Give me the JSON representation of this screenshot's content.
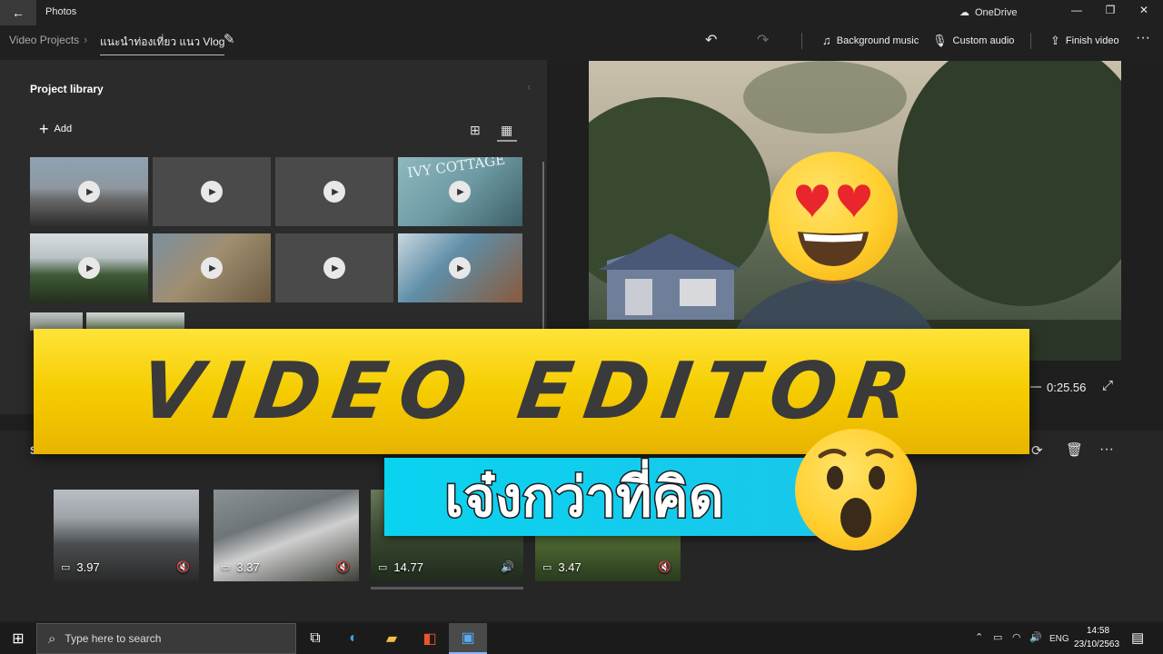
{
  "titlebar": {
    "back_icon": "←",
    "app_title": "Photos",
    "onedrive_icon": "☁",
    "onedrive_label": "OneDrive",
    "minimize_icon": "—",
    "maximize_icon": "❐",
    "close_icon": "✕"
  },
  "cmdbar": {
    "breadcrumb_root": "Video Projects",
    "breadcrumb_sep": "›",
    "project_name": "แนะนำท่องเที่ยว แนว Vlog",
    "edit_icon": "✎",
    "undo_icon": "↶",
    "redo_icon": "↷",
    "background_music_icon": "♫",
    "background_music_label": "Background music",
    "custom_audio_icon": "🎙",
    "custom_audio_label": "Custom audio",
    "finish_icon": "⇪",
    "finish_label": "Finish video",
    "more_icon": "···"
  },
  "library": {
    "title": "Project library",
    "collapse_icon": "‹",
    "add_icon": "+",
    "add_label": "Add",
    "view_large_icon": "⊞",
    "view_small_icon": "▦",
    "play_icon": "▶",
    "tile_text": "IVY COTTAGE"
  },
  "preview": {
    "time": "0:25.56",
    "fullscreen_icon": "⤢"
  },
  "storyboard": {
    "title_letter": "S",
    "rotate_icon": "⟳",
    "delete_icon": "🗑",
    "more_icon": "···",
    "frame_icon": "▭",
    "clips": [
      {
        "duration": "3.97",
        "audio_icon": "🔇"
      },
      {
        "duration": "3.37",
        "audio_icon": "🔇"
      },
      {
        "duration": "14.77",
        "audio_icon": "🔊"
      },
      {
        "duration": "3.47",
        "audio_icon": "🔇"
      }
    ]
  },
  "overlay": {
    "banner_text": "VIDEO EDITOR",
    "thai_text": "เจ๋งกว่าที่คิด"
  },
  "taskbar": {
    "start_icon": "⊞",
    "search_icon": "⌕",
    "search_placeholder": "Type here to search",
    "taskview_icon": "⧉",
    "edge_icon": "◐",
    "explorer_icon": "▰",
    "office_icon": "◧",
    "photos_icon": "▣",
    "chevron_icon": "⌃",
    "battery_icon": "▭",
    "wifi_icon": "◠",
    "volume_icon": "🔊",
    "language": "ENG",
    "time": "14:58",
    "date": "23/10/2563",
    "notification_icon": "▤"
  },
  "colors": {
    "banner_yellow": "#f5cc00",
    "thai_cyan": "#0ad3f0",
    "app_bg": "#1f1f1f"
  }
}
